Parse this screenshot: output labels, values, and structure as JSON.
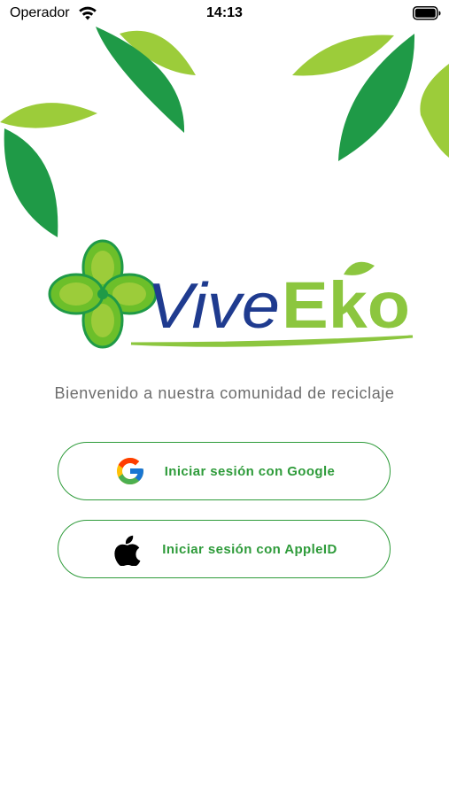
{
  "status_bar": {
    "carrier": "Operador",
    "time": "14:13",
    "icons": [
      "wifi-icon",
      "battery-icon"
    ]
  },
  "logo": {
    "text_part1": "Vive",
    "text_part2": "Eko",
    "icon": "clover-icon"
  },
  "welcome_text": "Bienvenido a nuestra comunidad de reciclaje",
  "buttons": {
    "google": {
      "label": "Iniciar sesión con Google",
      "icon": "google-icon"
    },
    "apple": {
      "label": "Iniciar sesión con AppleID",
      "icon": "apple-icon"
    }
  },
  "colors": {
    "accent_green": "#2e9b3a",
    "light_green": "#8cc63f",
    "logo_blue": "#1f3b8f",
    "text_gray": "#6d6d6d"
  }
}
